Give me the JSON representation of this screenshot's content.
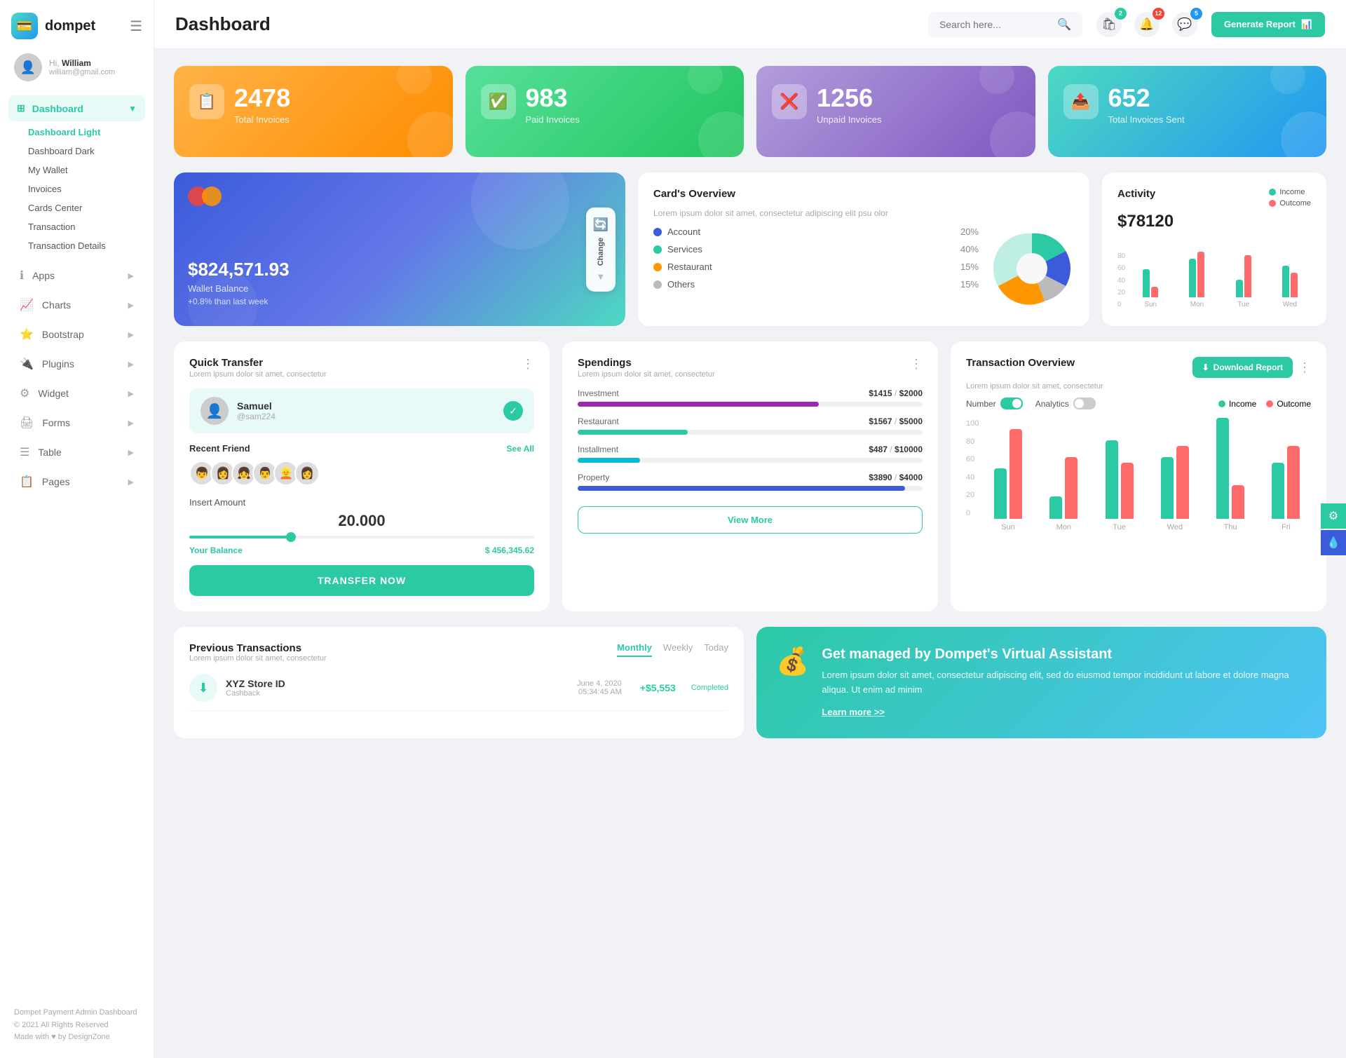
{
  "sidebar": {
    "logo_text": "dompet",
    "user": {
      "greeting": "Hi,",
      "name": "William",
      "email": "william@gmail.com"
    },
    "nav": {
      "dashboard_label": "Dashboard",
      "sub_items": [
        {
          "label": "Dashboard Light",
          "active": true
        },
        {
          "label": "Dashboard Dark"
        },
        {
          "label": "My Wallet"
        },
        {
          "label": "Invoices"
        },
        {
          "label": "Cards Center"
        },
        {
          "label": "Transaction"
        },
        {
          "label": "Transaction Details"
        }
      ],
      "items": [
        {
          "label": "Apps",
          "icon": "ℹ"
        },
        {
          "label": "Charts",
          "icon": "📈"
        },
        {
          "label": "Bootstrap",
          "icon": "⭐"
        },
        {
          "label": "Plugins",
          "icon": "🔌"
        },
        {
          "label": "Widget",
          "icon": "⚙"
        },
        {
          "label": "Forms",
          "icon": "🖨"
        },
        {
          "label": "Table",
          "icon": "☰"
        },
        {
          "label": "Pages",
          "icon": "📋"
        }
      ]
    },
    "footer": {
      "brand": "Dompet Payment Admin Dashboard",
      "copyright": "© 2021 All Rights Reserved",
      "made_with": "Made with ♥ by DesignZone"
    }
  },
  "header": {
    "title": "Dashboard",
    "search_placeholder": "Search here...",
    "icons": [
      {
        "name": "bag-icon",
        "badge": "2",
        "badge_color": "teal"
      },
      {
        "name": "bell-icon",
        "badge": "12",
        "badge_color": "red"
      },
      {
        "name": "chat-icon",
        "badge": "5",
        "badge_color": "blue"
      }
    ],
    "generate_report_label": "Generate Report"
  },
  "stat_cards": [
    {
      "number": "2478",
      "label": "Total Invoices",
      "color": "orange",
      "icon": "📋"
    },
    {
      "number": "983",
      "label": "Paid Invoices",
      "color": "green",
      "icon": "✅"
    },
    {
      "number": "1256",
      "label": "Unpaid Invoices",
      "color": "purple",
      "icon": "❌"
    },
    {
      "number": "652",
      "label": "Total Invoices Sent",
      "color": "teal",
      "icon": "📤"
    }
  ],
  "wallet_card": {
    "amount": "$824,571.93",
    "label": "Wallet Balance",
    "change": "+0.8% than last week",
    "change_btn_label": "Change"
  },
  "cards_overview": {
    "title": "Card's Overview",
    "subtitle": "Lorem ipsum dolor sit amet, consectetur adipiscing elit psu olor",
    "legend": [
      {
        "label": "Account",
        "pct": "20%",
        "color": "#3b5bdb"
      },
      {
        "label": "Services",
        "pct": "40%",
        "color": "#2cc9a5"
      },
      {
        "label": "Restaurant",
        "pct": "15%",
        "color": "#ff9800"
      },
      {
        "label": "Others",
        "pct": "15%",
        "color": "#bbb"
      }
    ]
  },
  "activity": {
    "title": "Activity",
    "amount": "$78120",
    "legend": [
      {
        "label": "Income",
        "color": "#2cc9a5"
      },
      {
        "label": "Outcome",
        "color": "#ff6b6b"
      }
    ],
    "bars": [
      {
        "label": "Sun",
        "income": 40,
        "outcome": 15
      },
      {
        "label": "Mon",
        "income": 55,
        "outcome": 65
      },
      {
        "label": "Tue",
        "income": 25,
        "outcome": 60
      },
      {
        "label": "Wed",
        "income": 45,
        "outcome": 35
      }
    ]
  },
  "quick_transfer": {
    "title": "Quick Transfer",
    "subtitle": "Lorem ipsum dolor sit amet, consectetur",
    "person": {
      "name": "Samuel",
      "handle": "@sam224"
    },
    "recent_friend_label": "Recent Friend",
    "see_all_label": "See All",
    "insert_amount_label": "Insert Amount",
    "amount": "20.000",
    "balance_label": "Your Balance",
    "balance_value": "$ 456,345.62",
    "transfer_btn_label": "TRANSFER NOW"
  },
  "spendings": {
    "title": "Spendings",
    "subtitle": "Lorem ipsum dolor sit amet, consectetur",
    "items": [
      {
        "name": "Investment",
        "current": "$1415",
        "max": "$2000",
        "pct": 70,
        "color": "#9c27b0"
      },
      {
        "name": "Restaurant",
        "current": "$1567",
        "max": "$5000",
        "pct": 32,
        "color": "#2cc9a5"
      },
      {
        "name": "Installment",
        "current": "$487",
        "max": "$10000",
        "pct": 18,
        "color": "#00bcd4"
      },
      {
        "name": "Property",
        "current": "$3890",
        "max": "$4000",
        "pct": 95,
        "color": "#3b5bdb"
      }
    ],
    "view_more_label": "View More"
  },
  "transaction_overview": {
    "title": "Transaction Overview",
    "subtitle": "Lorem ipsum dolor sit amet, consectetur",
    "download_label": "Download Report",
    "toggle_number": "Number",
    "toggle_analytics": "Analytics",
    "legend": [
      {
        "label": "Income",
        "color": "#2cc9a5"
      },
      {
        "label": "Outcome",
        "color": "#ff6b6b"
      }
    ],
    "bars": [
      {
        "label": "Sun",
        "income": 45,
        "outcome": 80
      },
      {
        "label": "Mon",
        "income": 20,
        "outcome": 55
      },
      {
        "label": "Tue",
        "income": 70,
        "outcome": 50
      },
      {
        "label": "Wed",
        "income": 55,
        "outcome": 65
      },
      {
        "label": "Thu",
        "income": 90,
        "outcome": 30
      },
      {
        "label": "Fri",
        "income": 50,
        "outcome": 65
      }
    ],
    "y_labels": [
      "100",
      "80",
      "60",
      "40",
      "20",
      "0"
    ]
  },
  "previous_transactions": {
    "title": "Previous Transactions",
    "subtitle": "Lorem ipsum dolor sit amet, consectetur",
    "tabs": [
      "Monthly",
      "Weekly",
      "Today"
    ],
    "active_tab": "Monthly",
    "items": [
      {
        "name": "XYZ Store ID",
        "sub": "Cashback",
        "date": "June 4, 2020",
        "time": "05:34:45 AM",
        "amount": "+$5,553",
        "status": "Completed",
        "positive": true
      }
    ]
  },
  "virtual_assistant": {
    "title": "Get managed by Dompet's Virtual Assistant",
    "text": "Lorem ipsum dolor sit amet, consectetur adipiscing elit, sed do eiusmod tempor incididunt ut labore et dolore magna aliqua. Ut enim ad minim",
    "learn_more": "Learn more >>"
  }
}
